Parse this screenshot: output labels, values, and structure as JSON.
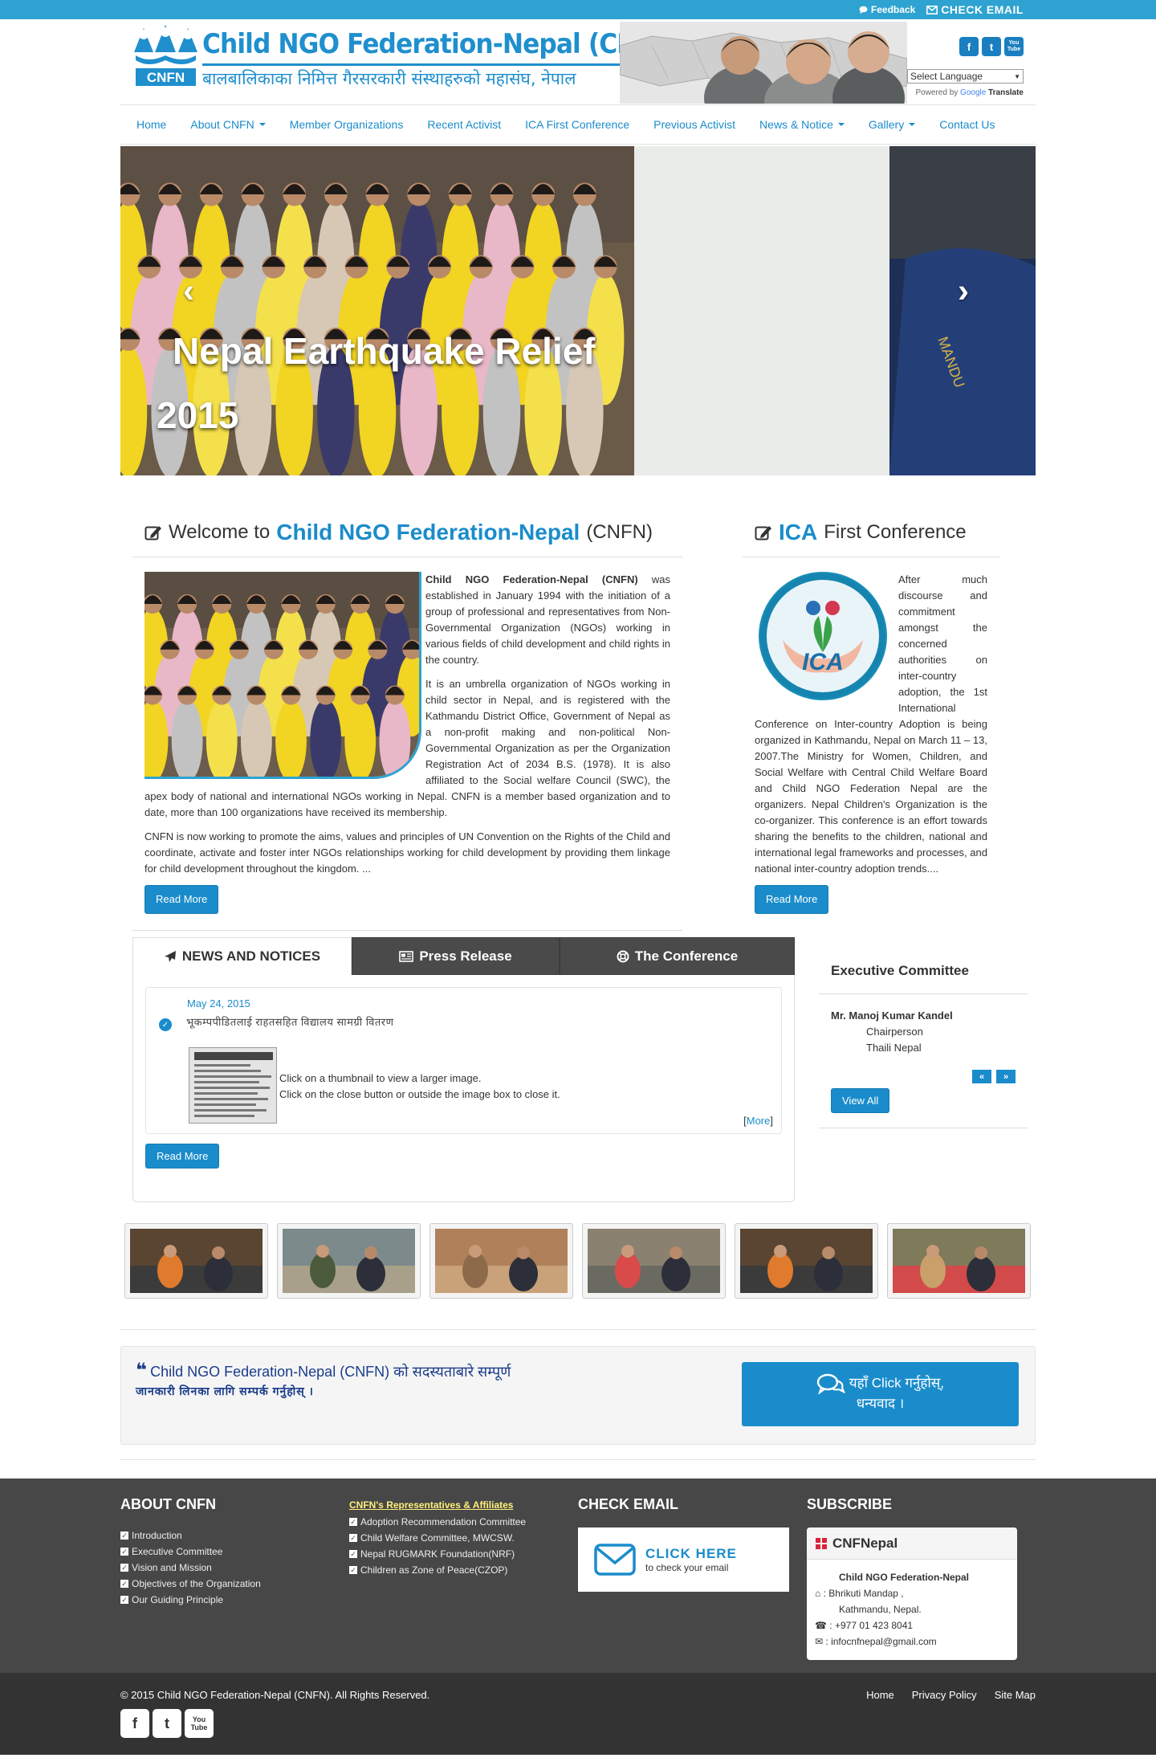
{
  "topbar": {
    "feedback": "Feedback",
    "check_email": "CHECK EMAIL"
  },
  "header": {
    "logo_title": "Child NGO Federation-Nepal (CNFN)",
    "logo_sub": "बालबालिकाका  निमित्त गैरसरकारी संस्थाहरुको महासंघ, नेपाल",
    "logo_mark_text": "CNFN",
    "language_select": "Select Language",
    "powered_by": "Powered by",
    "google": "Google",
    "translate": "Translate",
    "social": [
      "f",
      "t",
      "You Tube"
    ]
  },
  "nav": {
    "items": [
      {
        "label": "Home",
        "dropdown": false
      },
      {
        "label": "About CNFN",
        "dropdown": true
      },
      {
        "label": "Member Organizations",
        "dropdown": false
      },
      {
        "label": "Recent Activist",
        "dropdown": false
      },
      {
        "label": "ICA First Conference",
        "dropdown": false
      },
      {
        "label": "Previous Activist",
        "dropdown": false
      },
      {
        "label": "News & Notice",
        "dropdown": true
      },
      {
        "label": "Gallery",
        "dropdown": true
      },
      {
        "label": "Contact Us",
        "dropdown": false
      }
    ]
  },
  "slider": {
    "caption_line1": "Nepal Earthquake Relief",
    "caption_line2": "2015",
    "prev": "‹",
    "next": "›"
  },
  "welcome": {
    "title_pre": "Welcome to",
    "title_hl": "Child NGO Federation-Nepal",
    "title_post": "(CNFN)",
    "strong": "Child NGO Federation-Nepal (CNFN)",
    "p1": " was established in January 1994 with the initiation of a group of professional and representatives from Non-Governmental Organization (NGOs) working in various fields of child development and child rights in the country.",
    "p2": "It is an umbrella organization of NGOs working in child sector in Nepal, and is registered with the Kathmandu District Office, Government of Nepal as a non-profit making and non-political Non-Governmental Organization as per the Organization Registration Act of 2034 B.S. (1978). It is also affiliated to the Social welfare Council (SWC), the apex body of national and international NGOs working in Nepal. CNFN is a member based organization and to date, more than 100 organizations have received its membership.",
    "p3": "CNFN is now working to promote the aims, values and principles of UN Convention on the Rights of the Child and coordinate, activate and foster inter NGOs relationships working for child development by providing them linkage for child development throughout the kingdom. ...",
    "read_more": "Read More"
  },
  "ica": {
    "title_hl": "ICA",
    "title_post": "First Conference",
    "logo_text": "ICA",
    "body": "After much discourse and commitment amongst the concerned authorities on inter-country adoption, the 1st International Conference on Inter-country Adoption is being organized in Kathmandu, Nepal on March 11 – 13, 2007.The Ministry for Women, Children, and Social Welfare with Central Child Welfare Board and Child NGO Federation Nepal are the organizers. Nepal Children's Organization is the co-organizer. This conference is an effort towards sharing the benefits to the children, national and international legal frameworks and processes, and national inter-country adoption trends....",
    "read_more": "Read More"
  },
  "tabs": {
    "items": [
      "NEWS AND NOTICES",
      "Press Release",
      "The Conference"
    ],
    "news": {
      "date": "May 24, 2015",
      "title": "भूकम्पपीडितलाई राहतसहित विद्यालय सामग्री वितरण",
      "line1": "Click on a thumbnail to view a larger image.",
      "line2": "Click on the close button or outside the image box to close it.",
      "more": "More"
    },
    "read_more": "Read More"
  },
  "exec": {
    "title": "Executive Committee",
    "name": "Mr. Manoj Kumar Kandel",
    "role": "Chairperson",
    "org": "Thaili Nepal",
    "view_all": "View All"
  },
  "cta": {
    "line1": "Child NGO Federation-Nepal (CNFN) को सदस्यताबारे सम्पूर्ण",
    "line2": "जानकारी लिनका लागि सम्पर्क गर्नुहोस् । ",
    "btn1": "यहाँ Click गर्नुहोस्,",
    "btn2": "धन्यवाद ।"
  },
  "footer": {
    "about_title": "ABOUT CNFN",
    "about_items": [
      "Introduction",
      "Executive Committee",
      "Vision and Mission",
      "Objectives of the Organization",
      "Our Guiding Principle"
    ],
    "rep_title": "CNFN's Representatives & Affiliates",
    "rep_items": [
      "Adoption Recommendation Committee",
      "Child Welfare Committee, MWCSW.",
      "Nepal RUGMARK Foundation(NRF)",
      "Children as Zone of Peace(CZOP)"
    ],
    "email_title": "CHECK EMAIL",
    "email_big": "CLICK HERE",
    "email_small": "to check your email",
    "subscribe_title": "SUBSCRIBE",
    "sub_head": "CNFNepal",
    "sub_org": "Child NGO Federation-Nepal",
    "sub_addr1": ": Bhrikuti Mandap ,",
    "sub_addr2": "Kathmandu, Nepal.",
    "sub_phone": ": +977 01 423 8041",
    "sub_email": ": infocnfnepal@gmail.com"
  },
  "bottom": {
    "copyright": "© 2015 Child NGO Federation-Nepal (CNFN). All Rights Reserved.",
    "links": [
      "Home",
      "Privacy Policy",
      "Site Map"
    ],
    "social": [
      "f",
      "t",
      "You Tube"
    ]
  },
  "colors": {
    "brand": "#1a8ccb",
    "topbar": "#2ea3d1",
    "footer": "#474747",
    "bottom": "#333333",
    "tab_dark": "#4a4a4a"
  }
}
